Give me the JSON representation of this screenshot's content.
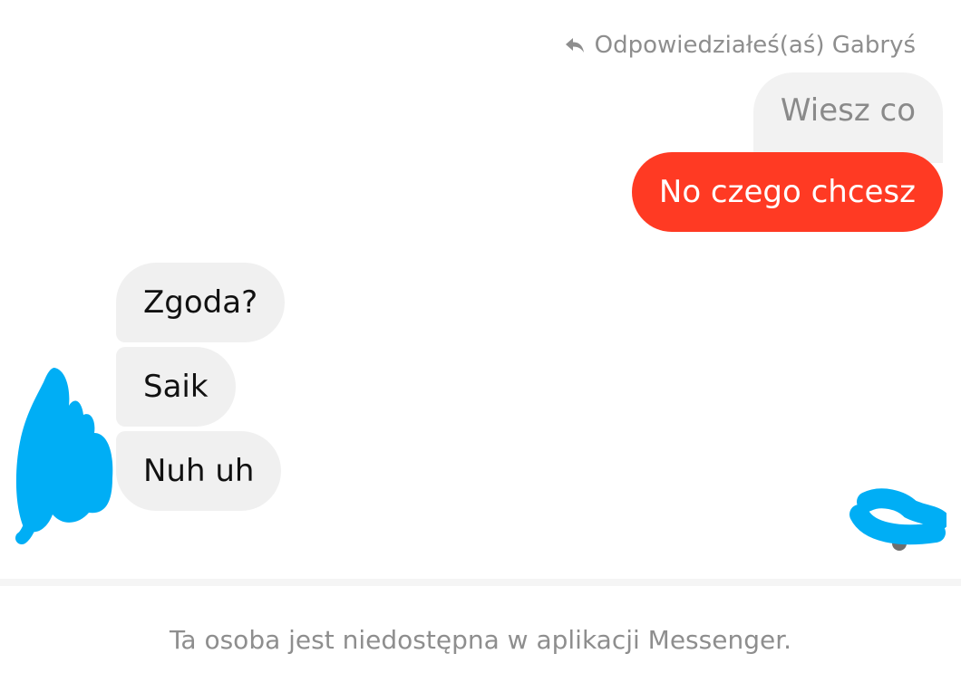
{
  "conversation": {
    "reply_context": {
      "icon": "reply-arrow-icon",
      "text": "Odpowiedziałeś(aś) Gabryś"
    },
    "quoted_message": "Wiesz co",
    "sent_messages": [
      "No czego chcesz"
    ],
    "received_messages": [
      "Zgoda?",
      "Saik",
      "Nuh uh"
    ]
  },
  "footer": {
    "status_text": "Ta osoba jest niedostępna w aplikacji Messenger."
  },
  "colors": {
    "outgoing_bubble": "#ff3a23",
    "incoming_bubble": "#f0f0f0",
    "quoted_bubble": "#f2f2f2",
    "scribble": "#00aef5",
    "muted_text": "#8e8e8e"
  }
}
